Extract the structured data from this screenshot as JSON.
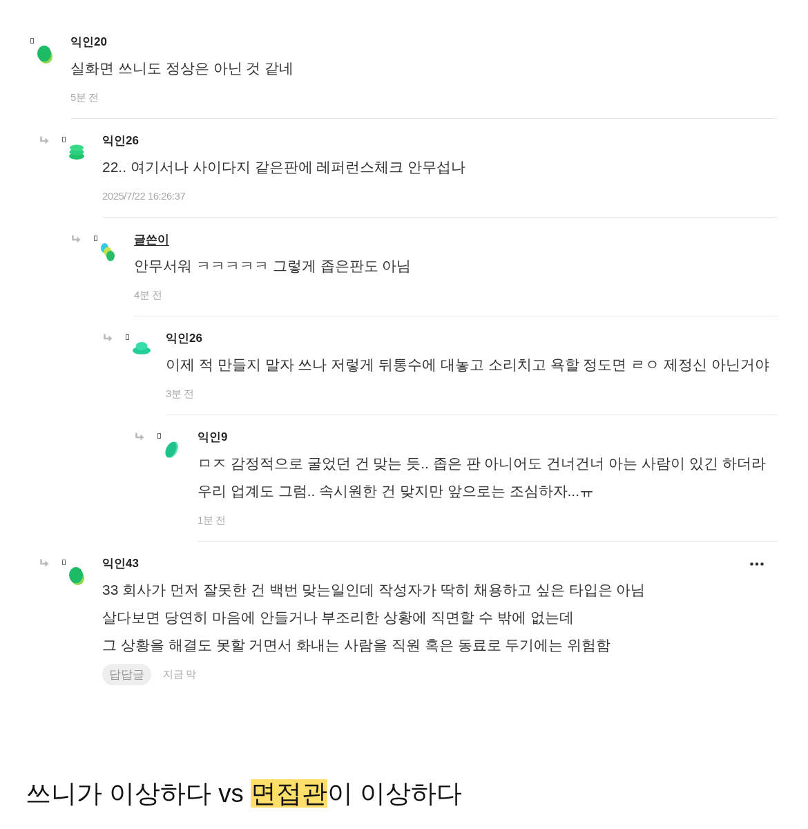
{
  "comments": [
    {
      "user": "익인20",
      "writer": false,
      "avatar": {
        "kind": "blob"
      },
      "text": "실화면 쓰니도 정상은 아닌 것 같네",
      "time": "5분 전",
      "show_more": false,
      "children": [
        {
          "user": "익인26",
          "writer": false,
          "avatar": {
            "kind": "stack"
          },
          "text": "22.. 여기서나 사이다지 같은판에 레퍼런스체크 안무섭나",
          "time": "2025/7/22 16:26:37",
          "show_more": false,
          "children": [
            {
              "user": "글쓴이",
              "writer": true,
              "avatar": {
                "kind": "cluster"
              },
              "text": "안무서워 ㅋㅋㅋㅋㅋ 그렇게 좁은판도 아님",
              "time": "4분 전",
              "show_more": false,
              "children": [
                {
                  "user": "익인26",
                  "writer": false,
                  "avatar": {
                    "kind": "mound"
                  },
                  "text": "이제 적 만들지 말자 쓰나 저렇게 뒤통수에 대놓고 소리치고 욕할 정도면 ㄹㅇ 제정신 아닌거야",
                  "time": "3분 전",
                  "show_more": false,
                  "children": [
                    {
                      "user": "익인9",
                      "writer": false,
                      "avatar": {
                        "kind": "oval"
                      },
                      "text": "ㅁㅈ 감정적으로 굴었던 건 맞는 듯.. 좁은 판 아니어도 건너건너 아는 사람이 있긴 하더라\n우리 업계도 그럼.. 속시원한 건 맞지만 앞으로는 조심하자...ㅠ",
                      "time": "1분 전",
                      "show_more": false
                    }
                  ]
                }
              ]
            }
          ]
        },
        {
          "user": "익인43",
          "writer": false,
          "avatar": {
            "kind": "blob"
          },
          "text": "33 회사가 먼저 잘못한 건 백번 맞는일인데 작성자가 딱히 채용하고 싶은 타입은 아님\n살다보면 당연히 마음에 안들거나 부조리한 상황에 직면할 수 밖에 없는데\n그 상황을 해결도 못할 거면서 화내는 사람을 직원 혹은 동료로 두기에는 위험함",
          "badge": "답답글",
          "time": "지금 막",
          "show_more": true
        }
      ]
    }
  ],
  "title": {
    "segments": [
      {
        "text": "쓰니가 이상하다 vs ",
        "highlighted": false
      },
      {
        "text": "면접관",
        "highlighted": true
      },
      {
        "text": "이 이상하다",
        "highlighted": false
      }
    ]
  }
}
